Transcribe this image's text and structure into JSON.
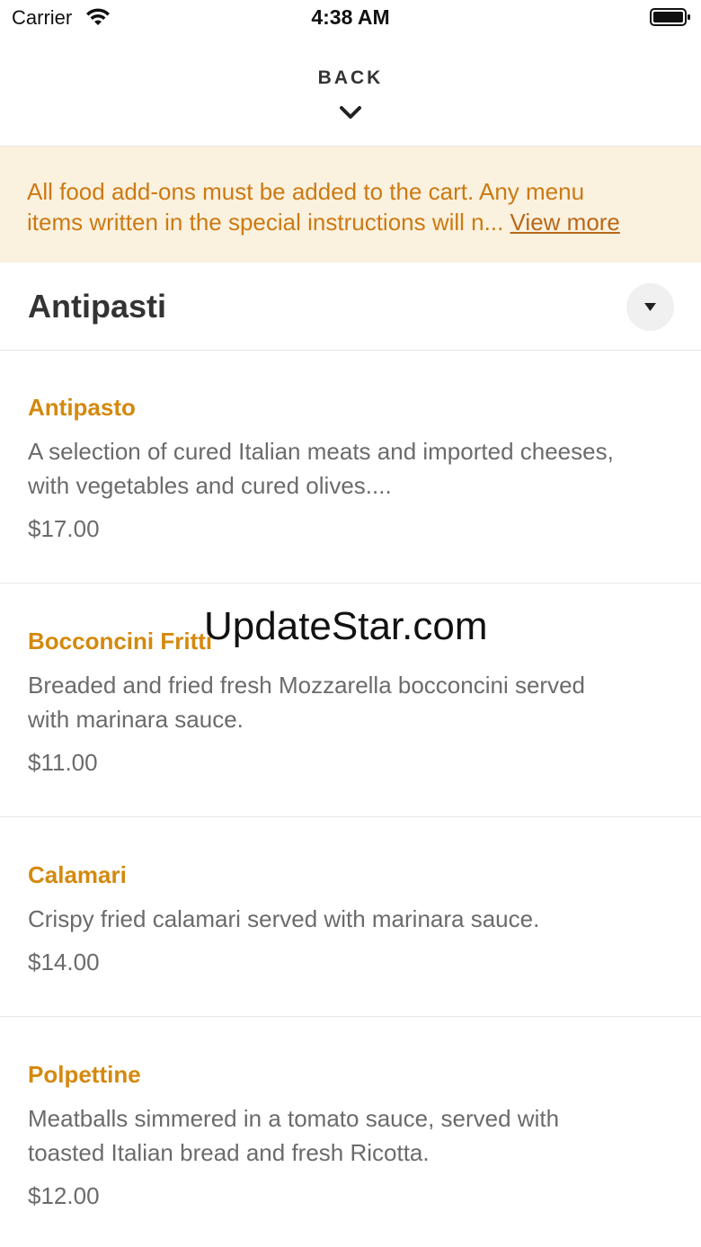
{
  "status_bar": {
    "carrier": "Carrier",
    "time": "4:38 AM"
  },
  "header": {
    "back_label": "BACK"
  },
  "notice": {
    "line1": "All food add-ons must be added to the cart. Any menu",
    "line2": "items written in the special instructions will n...",
    "link": "View more"
  },
  "section": {
    "title": "Antipasti"
  },
  "items": [
    {
      "name": "Antipasto",
      "desc_line1": "A selection of cured Italian meats and imported cheeses,",
      "desc_line2": "with vegetables and cured olives....",
      "price": "$17.00"
    },
    {
      "name": "Bocconcini Fritti",
      "desc_line1": "Breaded and fried fresh Mozzarella bocconcini served",
      "desc_line2": "with marinara sauce.",
      "price": "$11.00"
    },
    {
      "name": "Calamari",
      "desc_line1": "Crispy fried calamari served with marinara sauce.",
      "price": "$14.00"
    },
    {
      "name": "Polpettine",
      "desc_line1": "Meatballs simmered in a tomato sauce, served with",
      "desc_line2": "toasted Italian bread and fresh Ricotta.",
      "price": "$12.00"
    }
  ],
  "watermark": "UpdateStar.com",
  "colors": {
    "accent": "#d4890e",
    "notice_bg": "#fbf1df",
    "notice_text": "#cc7a12"
  }
}
